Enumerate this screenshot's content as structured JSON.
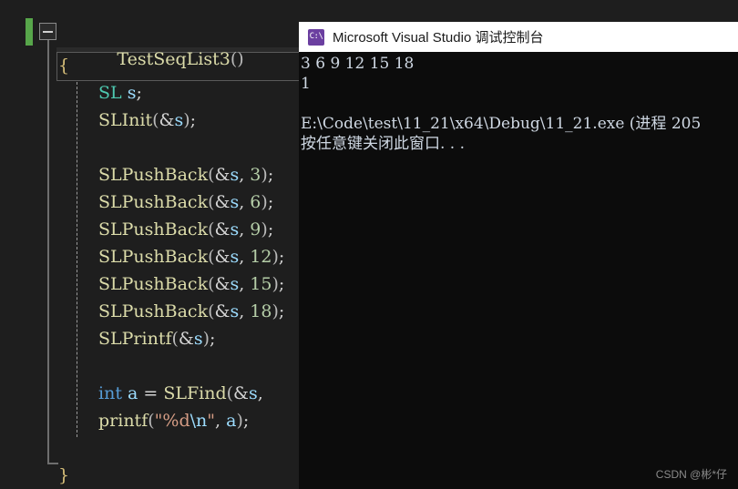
{
  "editor": {
    "signature_line": {
      "name": "TestSeqList3",
      "parens": "()"
    },
    "gutter": {
      "fold_minus_label": "collapse",
      "change_bar_color": "#57a64a"
    },
    "lines": [
      {
        "indent": 0,
        "tokens": [
          {
            "t": "{",
            "c": "brace"
          }
        ]
      },
      {
        "indent": 1,
        "tokens": [
          {
            "t": "SL",
            "c": "type"
          },
          {
            "t": " ",
            "c": "punc"
          },
          {
            "t": "s",
            "c": "var"
          },
          {
            "t": ";",
            "c": "punc"
          }
        ]
      },
      {
        "indent": 1,
        "tokens": [
          {
            "t": "SLInit",
            "c": "fn"
          },
          {
            "t": "(",
            "c": "paren"
          },
          {
            "t": "&",
            "c": "op"
          },
          {
            "t": "s",
            "c": "var"
          },
          {
            "t": ")",
            "c": "paren"
          },
          {
            "t": ";",
            "c": "punc"
          }
        ]
      },
      {
        "indent": 1,
        "tokens": []
      },
      {
        "indent": 1,
        "tokens": [
          {
            "t": "SLPushBack",
            "c": "fn"
          },
          {
            "t": "(",
            "c": "paren"
          },
          {
            "t": "&",
            "c": "op"
          },
          {
            "t": "s",
            "c": "var"
          },
          {
            "t": ", ",
            "c": "punc"
          },
          {
            "t": "3",
            "c": "num"
          },
          {
            "t": ")",
            "c": "paren"
          },
          {
            "t": ";",
            "c": "punc"
          }
        ]
      },
      {
        "indent": 1,
        "tokens": [
          {
            "t": "SLPushBack",
            "c": "fn"
          },
          {
            "t": "(",
            "c": "paren"
          },
          {
            "t": "&",
            "c": "op"
          },
          {
            "t": "s",
            "c": "var"
          },
          {
            "t": ", ",
            "c": "punc"
          },
          {
            "t": "6",
            "c": "num"
          },
          {
            "t": ")",
            "c": "paren"
          },
          {
            "t": ";",
            "c": "punc"
          }
        ]
      },
      {
        "indent": 1,
        "tokens": [
          {
            "t": "SLPushBack",
            "c": "fn"
          },
          {
            "t": "(",
            "c": "paren"
          },
          {
            "t": "&",
            "c": "op"
          },
          {
            "t": "s",
            "c": "var"
          },
          {
            "t": ", ",
            "c": "punc"
          },
          {
            "t": "9",
            "c": "num"
          },
          {
            "t": ")",
            "c": "paren"
          },
          {
            "t": ";",
            "c": "punc"
          }
        ]
      },
      {
        "indent": 1,
        "tokens": [
          {
            "t": "SLPushBack",
            "c": "fn"
          },
          {
            "t": "(",
            "c": "paren"
          },
          {
            "t": "&",
            "c": "op"
          },
          {
            "t": "s",
            "c": "var"
          },
          {
            "t": ", ",
            "c": "punc"
          },
          {
            "t": "12",
            "c": "num"
          },
          {
            "t": ")",
            "c": "paren"
          },
          {
            "t": ";",
            "c": "punc"
          }
        ]
      },
      {
        "indent": 1,
        "tokens": [
          {
            "t": "SLPushBack",
            "c": "fn"
          },
          {
            "t": "(",
            "c": "paren"
          },
          {
            "t": "&",
            "c": "op"
          },
          {
            "t": "s",
            "c": "var"
          },
          {
            "t": ", ",
            "c": "punc"
          },
          {
            "t": "15",
            "c": "num"
          },
          {
            "t": ")",
            "c": "paren"
          },
          {
            "t": ";",
            "c": "punc"
          }
        ]
      },
      {
        "indent": 1,
        "tokens": [
          {
            "t": "SLPushBack",
            "c": "fn"
          },
          {
            "t": "(",
            "c": "paren"
          },
          {
            "t": "&",
            "c": "op"
          },
          {
            "t": "s",
            "c": "var"
          },
          {
            "t": ", ",
            "c": "punc"
          },
          {
            "t": "18",
            "c": "num"
          },
          {
            "t": ")",
            "c": "paren"
          },
          {
            "t": ";",
            "c": "punc"
          }
        ]
      },
      {
        "indent": 1,
        "tokens": [
          {
            "t": "SLPrintf",
            "c": "fn"
          },
          {
            "t": "(",
            "c": "paren"
          },
          {
            "t": "&",
            "c": "op"
          },
          {
            "t": "s",
            "c": "var"
          },
          {
            "t": ")",
            "c": "paren"
          },
          {
            "t": ";",
            "c": "punc"
          }
        ]
      },
      {
        "indent": 1,
        "tokens": []
      },
      {
        "indent": 1,
        "tokens": [
          {
            "t": "int",
            "c": "kw"
          },
          {
            "t": " ",
            "c": "punc"
          },
          {
            "t": "a",
            "c": "var"
          },
          {
            "t": " = ",
            "c": "op"
          },
          {
            "t": "SLFind",
            "c": "fn"
          },
          {
            "t": "(",
            "c": "paren"
          },
          {
            "t": "&",
            "c": "op"
          },
          {
            "t": "s",
            "c": "var"
          },
          {
            "t": ",",
            "c": "punc"
          }
        ]
      },
      {
        "indent": 1,
        "tokens": [
          {
            "t": "printf",
            "c": "fn"
          },
          {
            "t": "(",
            "c": "paren"
          },
          {
            "t": "\"%d",
            "c": "str"
          },
          {
            "t": "\\n",
            "c": "esc"
          },
          {
            "t": "\"",
            "c": "str"
          },
          {
            "t": ", ",
            "c": "punc"
          },
          {
            "t": "a",
            "c": "var"
          },
          {
            "t": ")",
            "c": "paren"
          },
          {
            "t": ";",
            "c": "punc"
          }
        ]
      },
      {
        "indent": 1,
        "tokens": []
      },
      {
        "indent": 0,
        "tokens": [
          {
            "t": "}",
            "c": "brace"
          }
        ]
      }
    ]
  },
  "console": {
    "title": "Microsoft Visual Studio 调试控制台",
    "icon_glyph": "C:\\",
    "output_lines": [
      "3 6 9 12 15 18",
      "1",
      "",
      "E:\\Code\\test\\11_21\\x64\\Debug\\11_21.exe (进程 205",
      "按任意键关闭此窗口. . ."
    ]
  },
  "watermark": {
    "text": "CSDN @彬*仔"
  }
}
